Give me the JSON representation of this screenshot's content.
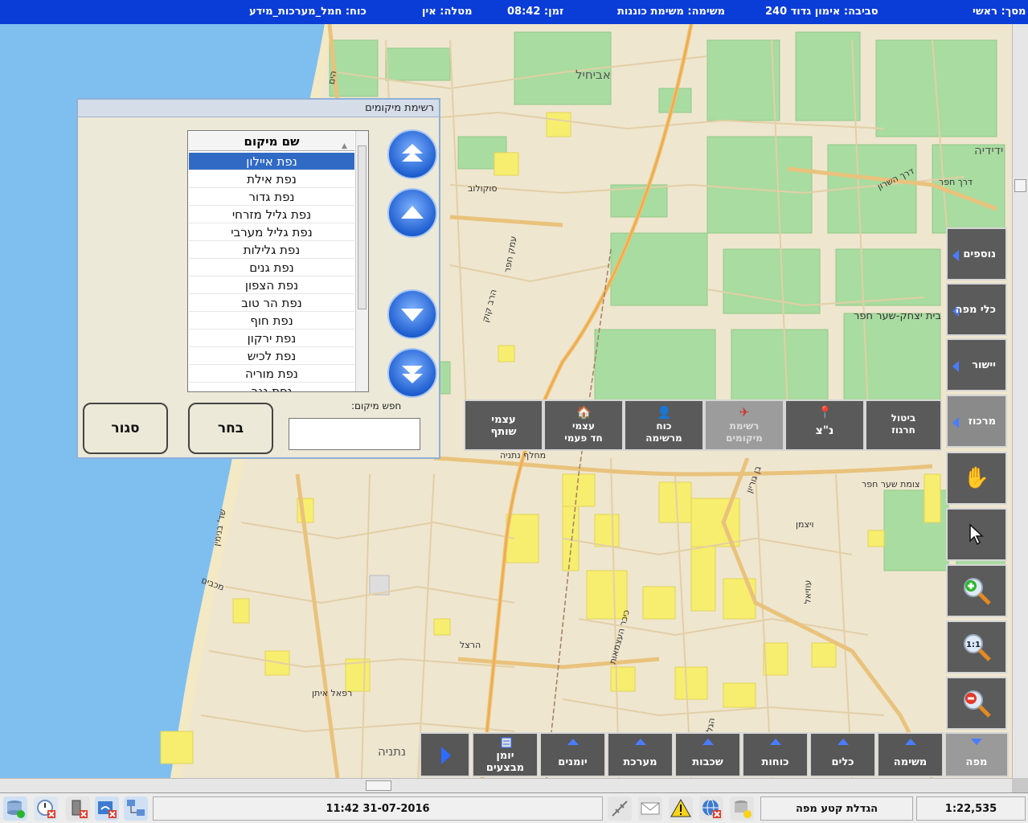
{
  "topbar": {
    "screen": "מסך: ראשי",
    "environment": "סביבה: אימון גדוד 240",
    "mission": "משימה: משימת כוננות",
    "time": "זמן: 08:42",
    "task": "מטלה: אין",
    "force": "כוח: חמל_מערכות_מידע"
  },
  "map_labels": {
    "city_north": "אביחיל",
    "city_east": "ידידיה",
    "city_south": "נתניה",
    "neighborhood": "בית יצחק-שער חפר",
    "junction": "צומת שער חפר",
    "interchange": "מחלף נתניה",
    "street_1": "סוקולוב",
    "street_2": "עמק חפר",
    "street_3": "דרך השרון",
    "street_4": "דרך חפר",
    "street_5": "הרב קוק",
    "street_6": "הרצל",
    "street_7": "בן גוריון",
    "street_8": "שד' בנימין",
    "street_9": "רפאל איתן",
    "street_10": "ויצמן",
    "street_11": "הגליל",
    "street_12": "כיכר העצמאות",
    "street_13": "עוזיאל",
    "street_14": "הים",
    "street_15": "מכבים"
  },
  "right_toolbar": {
    "more": "נוספים",
    "map_tools": "כלי מפה",
    "settlement": "יישור",
    "center": "מרכוז"
  },
  "context_toolbar": {
    "cancel_trace": "ביטול\nחרגוז",
    "nz": "נ\"צ",
    "locations_list": "רשימת\nמיקומים",
    "force_from_list": "כוח\nמרשימה",
    "one_time_object": "עצמי\nחד פעמי",
    "shared_object": "עצמי\nשותף"
  },
  "bottom_toolbar": {
    "map": "מפה",
    "mission": "משימה",
    "tools": "כלים",
    "forces": "כוחות",
    "layers": "שכבות",
    "system": "מערכת",
    "logs": "יומנים",
    "ops_log": "יומן\nמבצעים"
  },
  "dialog": {
    "title": "רשימת מיקומים",
    "column_header": "שם מיקום",
    "items": [
      "נפת איילון",
      "נפת אילת",
      "נפת גדור",
      "נפת גליל מזרחי",
      "נפת גליל מערבי",
      "נפת גלילות",
      "נפת גנים",
      "נפת הצפון",
      "נפת הר טוב",
      "נפת חוף",
      "נפת ירקון",
      "נפת לכיש",
      "נפת מוריה",
      "נפת נגב"
    ],
    "selected_index": 0,
    "search_label": "חפש מיקום:",
    "search_value": "",
    "select_button": "בחר",
    "close_button": "סגור"
  },
  "statusbar": {
    "datetime": "31-07-2016  11:42",
    "status_text": "הגדלת קטע מפה",
    "scale": "1:22,535"
  },
  "colors": {
    "topbar": "#0a3cd8",
    "water": "#7fbfef",
    "land": "#efe6cf",
    "green": "#a9dca0",
    "yellow": "#f7ee6f",
    "road": "#e9c27c",
    "toolbar": "#575757",
    "accent": "#4a7cff"
  }
}
